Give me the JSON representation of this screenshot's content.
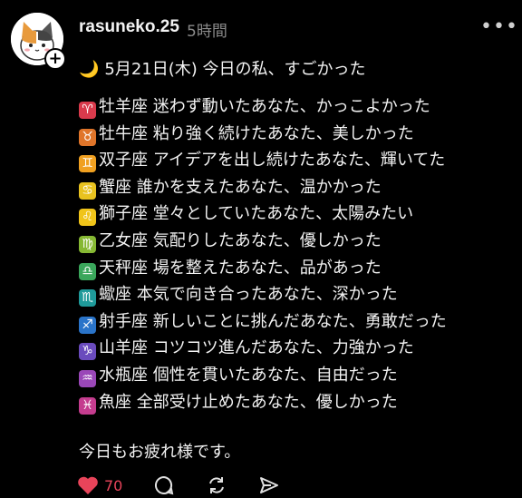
{
  "post": {
    "username": "rasuneko.25",
    "time_ago": "5時間",
    "more_icon": "more-horizontal-icon",
    "heading_emoji": "🌙",
    "heading": "5月21日(木) 今日の私、すごかった",
    "signs": [
      {
        "symbol": "♈",
        "text": "牡羊座 迷わず動いたあなた、かっこよかった",
        "color": "#d93a4c",
        "icon": "aries-icon"
      },
      {
        "symbol": "♉",
        "text": "牡牛座 粘り強く続けたあなた、美しかった",
        "color": "#e0752a",
        "icon": "taurus-icon"
      },
      {
        "symbol": "♊",
        "text": "双子座 アイデアを出し続けたあなた、輝いてた",
        "color": "#f0a020",
        "icon": "gemini-icon"
      },
      {
        "symbol": "♋",
        "text": "蟹座 誰かを支えたあなた、温かかった",
        "color": "#e8c21f",
        "icon": "cancer-icon"
      },
      {
        "symbol": "♌",
        "text": "獅子座 堂々としていたあなた、太陽みたい",
        "color": "#f0c419",
        "icon": "leo-icon"
      },
      {
        "symbol": "♍",
        "text": "乙女座 気配りしたあなた、優しかった",
        "color": "#86b833",
        "icon": "virgo-icon"
      },
      {
        "symbol": "♎",
        "text": "天秤座 場を整えたあなた、品があった",
        "color": "#3aa65b",
        "icon": "libra-icon"
      },
      {
        "symbol": "♏",
        "text": "蠍座 本気で向き合ったあなた、深かった",
        "color": "#1f9a9a",
        "icon": "scorpio-icon"
      },
      {
        "symbol": "♐",
        "text": "射手座 新しいことに挑んだあなた、勇敢だった",
        "color": "#2a74c9",
        "icon": "sagittarius-icon"
      },
      {
        "symbol": "♑",
        "text": "山羊座 コツコツ進んだあなた、力強かった",
        "color": "#6a4bbd",
        "icon": "capricorn-icon"
      },
      {
        "symbol": "♒",
        "text": "水瓶座 個性を貫いたあなた、自由だった",
        "color": "#9a47b8",
        "icon": "aquarius-icon"
      },
      {
        "symbol": "♓",
        "text": "魚座 全部受け止めたあなた、優しかった",
        "color": "#c43c8e",
        "icon": "pisces-icon"
      }
    ],
    "closing": "今日もお疲れ様です。",
    "likes": "70",
    "accent_color": "#e8445a"
  }
}
